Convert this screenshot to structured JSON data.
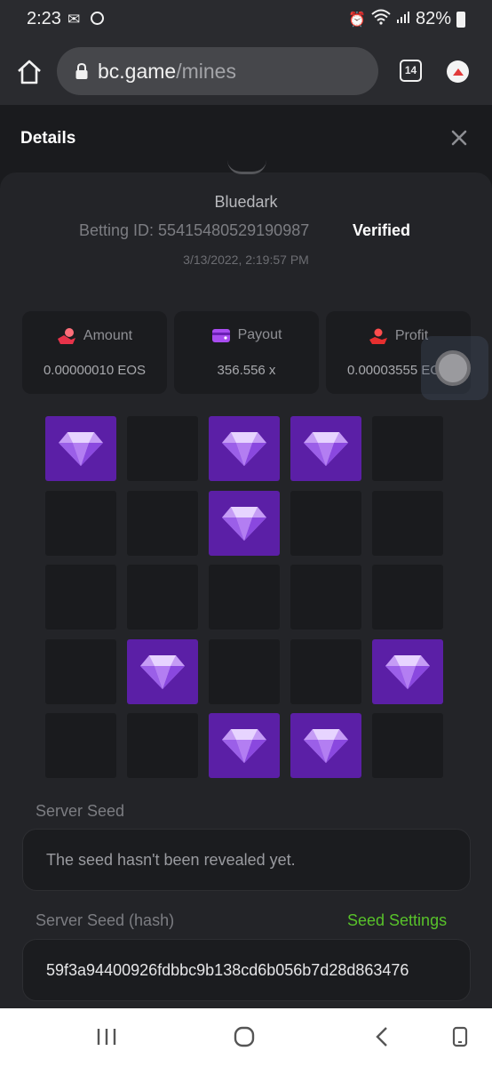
{
  "status_bar": {
    "time": "2:23",
    "battery": "82%"
  },
  "browser": {
    "url_host": "bc.game",
    "url_path": "/mines",
    "tab_count": "14"
  },
  "details": {
    "title": "Details",
    "username": "Bluedark",
    "betting_id": "Betting ID: 55415480529190987",
    "verified_label": "Verified",
    "datetime": "3/13/2022, 2:19:57 PM"
  },
  "stats": [
    {
      "label": "Amount",
      "value": "0.00000010 EOS",
      "icon": "coin-hand-icon"
    },
    {
      "label": "Payout",
      "value": "356.556 x",
      "icon": "wallet-icon"
    },
    {
      "label": "Profit",
      "value": "0.00003555 EOS",
      "icon": "profit-hand-icon"
    }
  ],
  "board": {
    "rows": 5,
    "cols": 5,
    "revealed_gems": [
      [
        0,
        0
      ],
      [
        0,
        2
      ],
      [
        0,
        3
      ],
      [
        1,
        2
      ],
      [
        3,
        1
      ],
      [
        3,
        4
      ],
      [
        4,
        2
      ],
      [
        4,
        3
      ]
    ],
    "gem_color": "#5b1fa6"
  },
  "server_seed": {
    "label": "Server Seed",
    "value": "The seed hasn't been revealed yet."
  },
  "server_seed_hash": {
    "label": "Server Seed (hash)",
    "settings_label": "Seed Settings",
    "value": "59f3a94400926fdbbc9b138cd6b056b7d28d863476"
  },
  "colors": {
    "accent_green": "#58c22a",
    "gem_purple": "#5b1fa6",
    "panel": "#232428"
  }
}
